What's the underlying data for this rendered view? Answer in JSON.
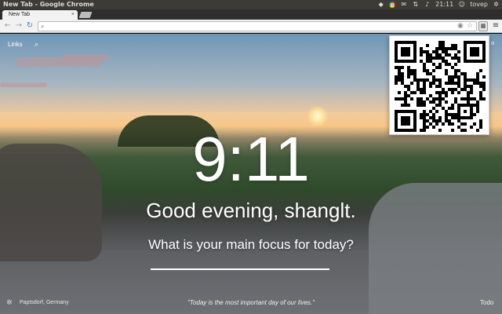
{
  "system_bar": {
    "window_title": "New Tab - Google Chrome",
    "clock": "21:11",
    "user": "tovep",
    "icons": [
      "dropbox-icon",
      "chrome-icon",
      "mail-icon",
      "network-icon",
      "volume-icon",
      "user-icon",
      "gear-icon"
    ]
  },
  "tabs": [
    {
      "label": "New Tab",
      "close": "×",
      "active": true
    }
  ],
  "toolbar": {
    "back": "←",
    "forward": "→",
    "reload": "↻",
    "search_icon": "⌕",
    "address_value": "",
    "address_placeholder": "",
    "menu": "≡"
  },
  "page": {
    "links_label": "Links",
    "search_icon": "⌕",
    "clock": "9:11",
    "greeting": "Good evening, shanglt.",
    "focus_question": "What is your main focus for today?",
    "focus_value": "",
    "location": "Paptsdorf, Germany",
    "quote": "\"Today is the most important day of our lives.\"",
    "todo": "Todo",
    "topright": "o"
  },
  "colors": {
    "system_bar": "#3c3b37",
    "toolbar": "#f2f2f2",
    "overlay_text": "#ffffff"
  }
}
